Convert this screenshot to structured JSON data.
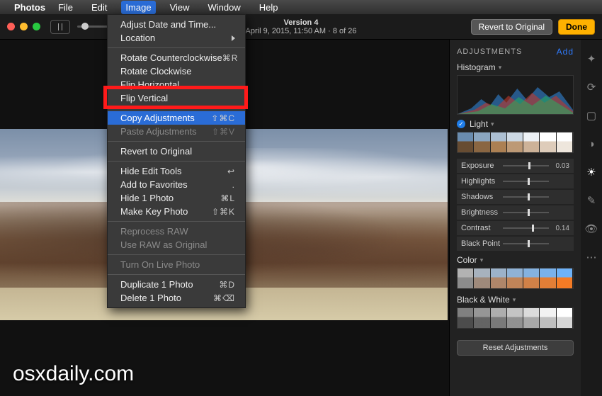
{
  "menubar": {
    "app": "Photos",
    "items": [
      "File",
      "Edit",
      "Image",
      "View",
      "Window",
      "Help"
    ],
    "activeIndex": 2
  },
  "toolbar": {
    "title_line1": "Version 4",
    "title_line2": "April 9, 2015, 11:50 AM  ·  8 of 26",
    "revert_label": "Revert to Original",
    "done_label": "Done"
  },
  "dropdown": {
    "items": [
      {
        "label": "Adjust Date and Time...",
        "shortcut": "",
        "disabled": false,
        "submenu": false
      },
      {
        "label": "Location",
        "shortcut": "",
        "disabled": false,
        "submenu": true
      },
      {
        "sep": true
      },
      {
        "label": "Rotate Counterclockwise",
        "shortcut": "⌘R",
        "disabled": false
      },
      {
        "label": "Rotate Clockwise",
        "shortcut": "",
        "disabled": false
      },
      {
        "label": "Flip Horizontal",
        "shortcut": "",
        "disabled": false
      },
      {
        "label": "Flip Vertical",
        "shortcut": "",
        "disabled": false
      },
      {
        "sep": true
      },
      {
        "label": "Copy Adjustments",
        "shortcut": "⇧⌘C",
        "disabled": false,
        "selected": true
      },
      {
        "label": "Paste Adjustments",
        "shortcut": "⇧⌘V",
        "disabled": true
      },
      {
        "sep": true
      },
      {
        "label": "Revert to Original",
        "shortcut": "",
        "disabled": false
      },
      {
        "sep": true
      },
      {
        "label": "Hide Edit Tools",
        "shortcut": "↩",
        "disabled": false
      },
      {
        "label": "Add to Favorites",
        "shortcut": ".",
        "disabled": false
      },
      {
        "label": "Hide 1 Photo",
        "shortcut": "⌘L",
        "disabled": false
      },
      {
        "label": "Make Key Photo",
        "shortcut": "⇧⌘K",
        "disabled": false
      },
      {
        "sep": true
      },
      {
        "label": "Reprocess RAW",
        "shortcut": "",
        "disabled": true
      },
      {
        "label": "Use RAW as Original",
        "shortcut": "",
        "disabled": true
      },
      {
        "sep": true
      },
      {
        "label": "Turn On Live Photo",
        "shortcut": "",
        "disabled": true
      },
      {
        "sep": true
      },
      {
        "label": "Duplicate 1 Photo",
        "shortcut": "⌘D",
        "disabled": false
      },
      {
        "label": "Delete 1 Photo",
        "shortcut": "⌘⌫",
        "disabled": false
      }
    ]
  },
  "panel": {
    "heading": "ADJUSTMENTS",
    "add_label": "Add",
    "histogram_label": "Histogram",
    "sections": {
      "light": {
        "title": "Light",
        "sliders": [
          {
            "name": "Exposure",
            "value": "0.03",
            "pos": 0.52
          },
          {
            "name": "Highlights",
            "value": "",
            "pos": 0.5
          },
          {
            "name": "Shadows",
            "value": "",
            "pos": 0.5
          },
          {
            "name": "Brightness",
            "value": "",
            "pos": 0.5
          },
          {
            "name": "Contrast",
            "value": "0.14",
            "pos": 0.58
          },
          {
            "name": "Black Point",
            "value": "",
            "pos": 0.5
          }
        ]
      },
      "color": {
        "title": "Color"
      },
      "bw": {
        "title": "Black & White"
      }
    },
    "reset_label": "Reset Adjustments"
  },
  "toolstrip": {
    "items": [
      {
        "name": "magic-wand-icon"
      },
      {
        "name": "rotate-icon"
      },
      {
        "name": "crop-icon"
      },
      {
        "name": "filters-icon"
      },
      {
        "name": "adjust-icon",
        "active": true
      },
      {
        "name": "retouch-icon"
      },
      {
        "name": "redeye-icon"
      },
      {
        "name": "more-icon"
      }
    ]
  },
  "watermark": "osxdaily.com"
}
